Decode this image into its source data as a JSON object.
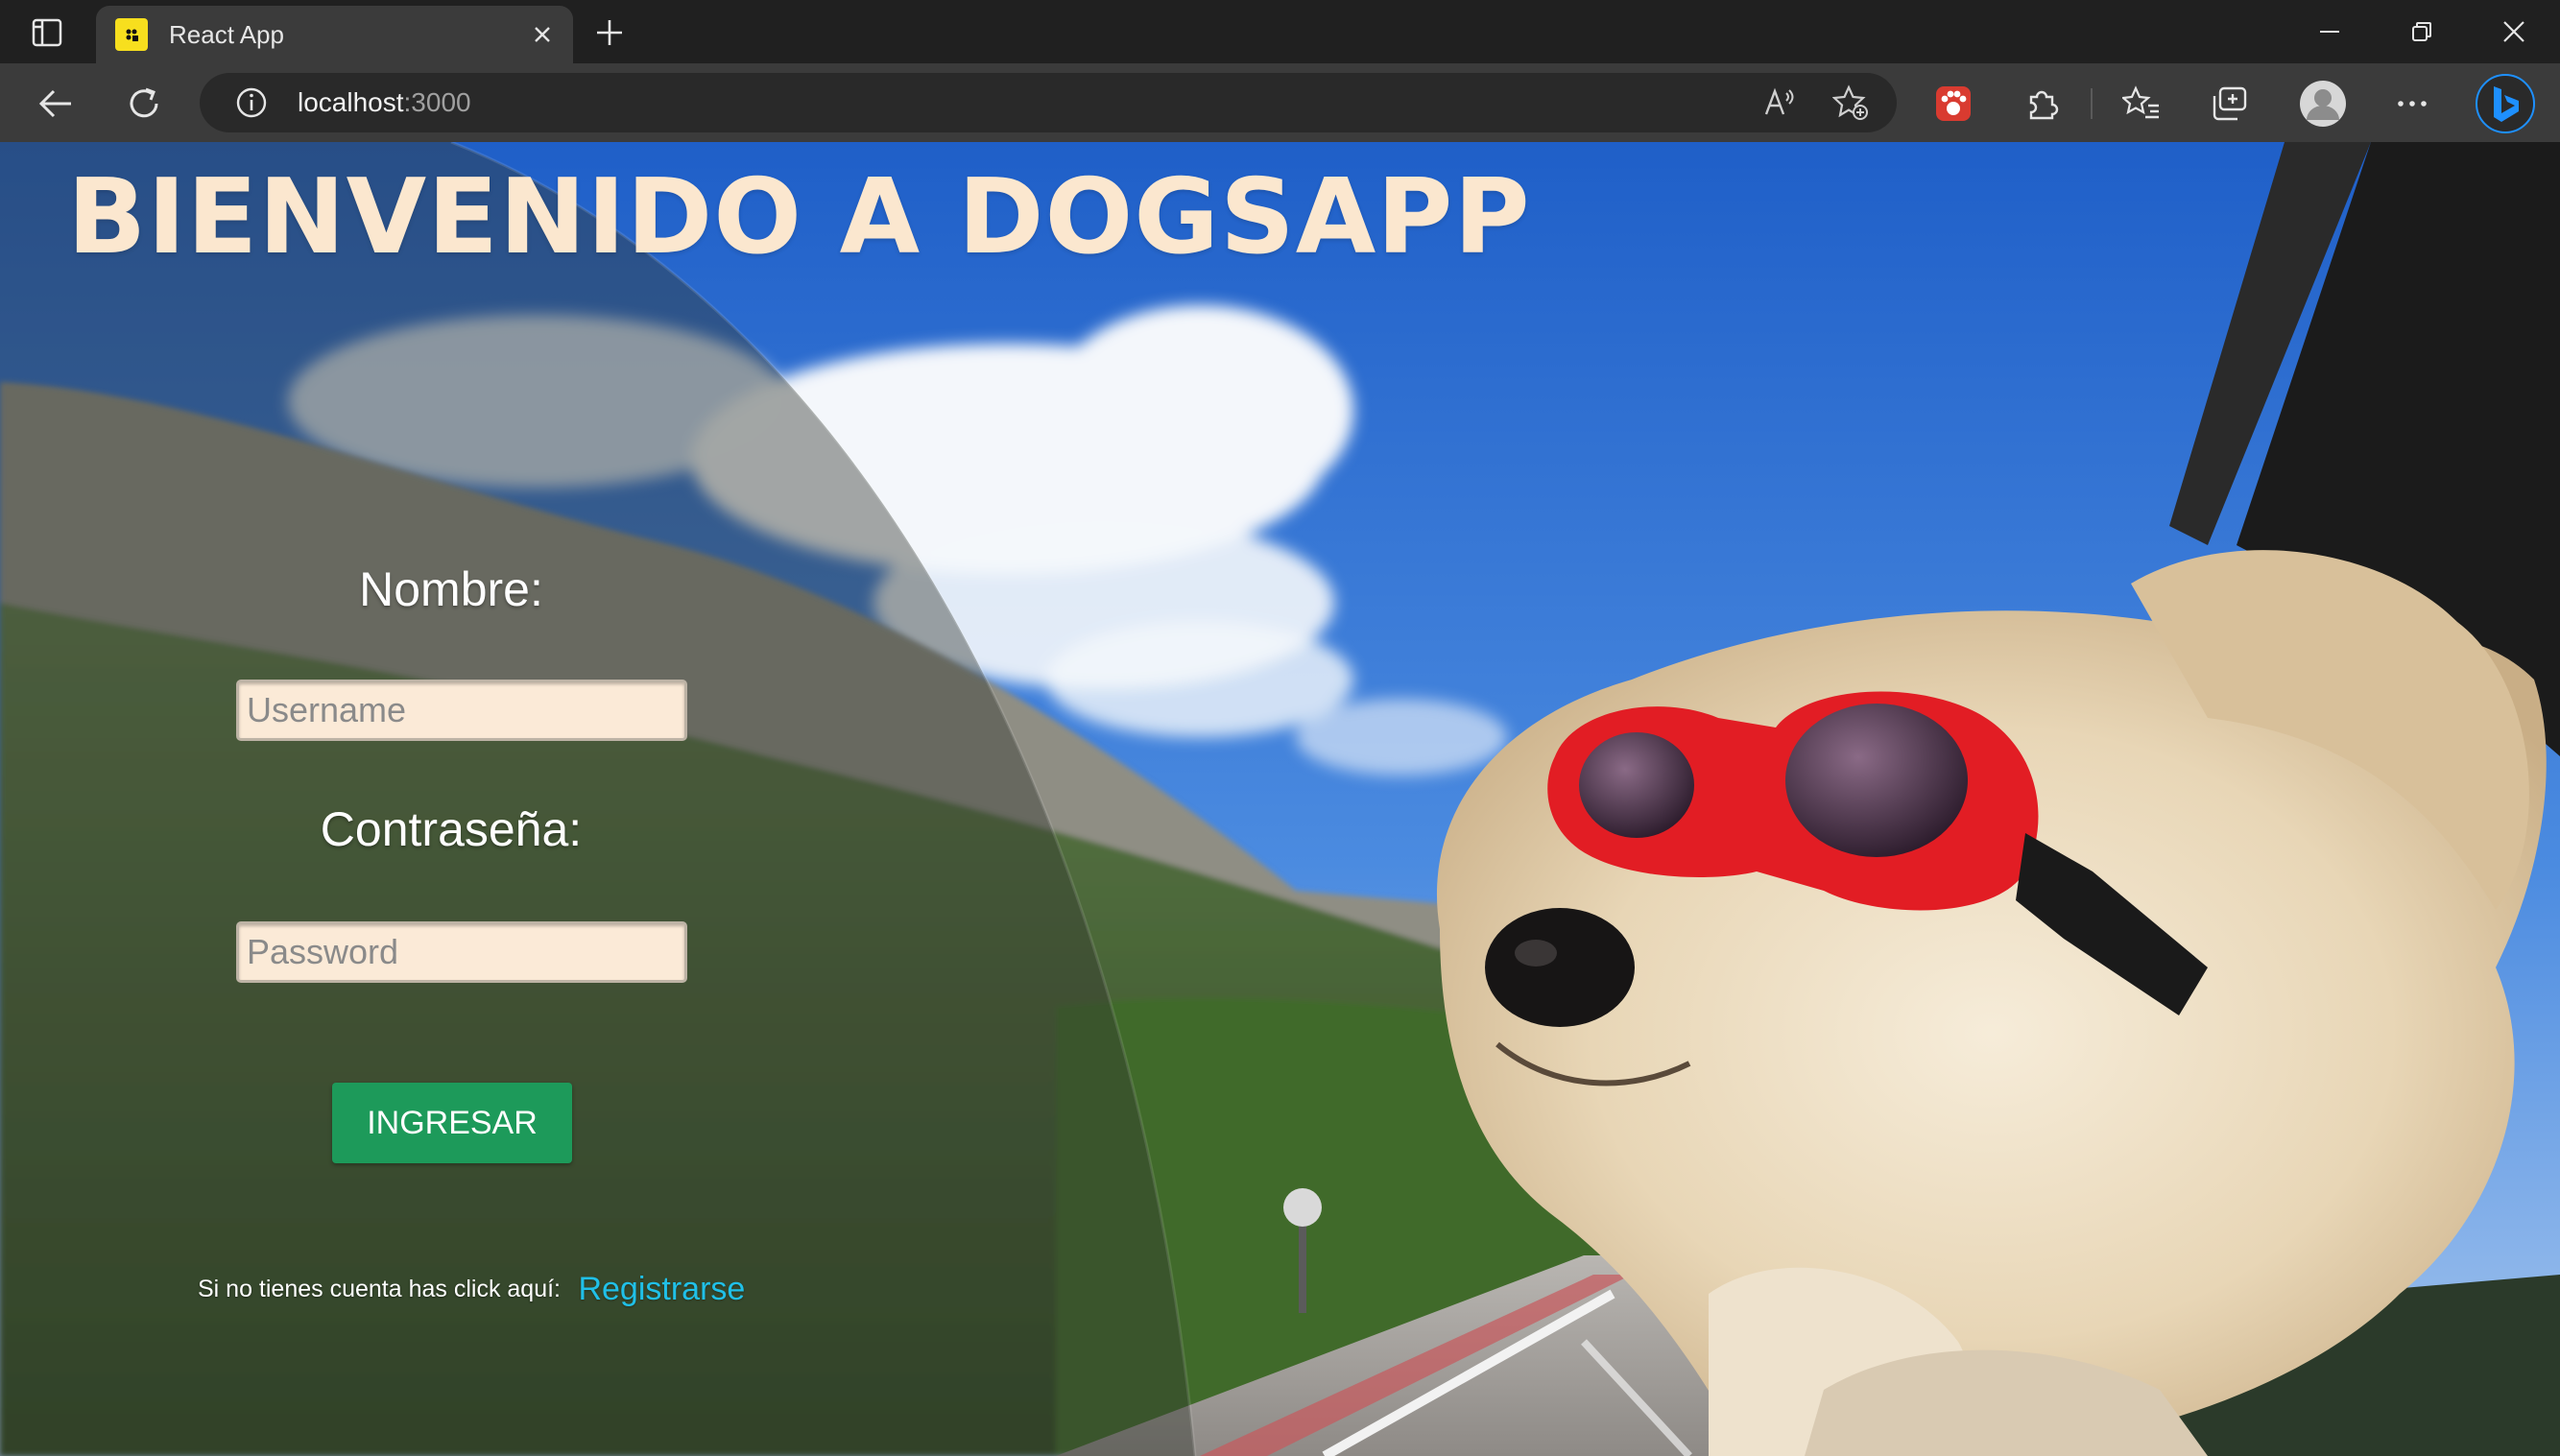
{
  "browser": {
    "tab_title": "React App",
    "address_host": "localhost",
    "address_port": ":3000",
    "colors": {
      "chrome": "#202020",
      "toolbar": "#3b3b3b",
      "omnibox": "#292929",
      "accent_bing": "#1e90ff"
    },
    "icons": [
      "tab-actions-icon",
      "react-favicon-icon",
      "close-tab-icon",
      "new-tab-icon",
      "minimize-icon",
      "restore-icon",
      "close-window-icon",
      "back-icon",
      "refresh-icon",
      "site-info-icon",
      "read-aloud-icon",
      "add-favorite-icon",
      "extension-paw-icon",
      "extensions-icon",
      "favorites-icon",
      "collections-icon",
      "profile-avatar-icon",
      "more-options-icon",
      "bing-copilot-icon"
    ]
  },
  "page": {
    "title": "BIENVENIDO A DOGSAPP",
    "form": {
      "username_label": "Nombre:",
      "username_placeholder": "Username",
      "password_label": "Contraseña:",
      "password_placeholder": "Password",
      "submit_label": "INGRESAR"
    },
    "signup": {
      "prompt": "Si no tienes cuenta has click aquí:",
      "link": "Registrarse"
    },
    "colors": {
      "title": "#fbe7cf",
      "button": "#1d9a5a",
      "link": "#20c0e8",
      "input_bg": "#fbead7"
    }
  }
}
